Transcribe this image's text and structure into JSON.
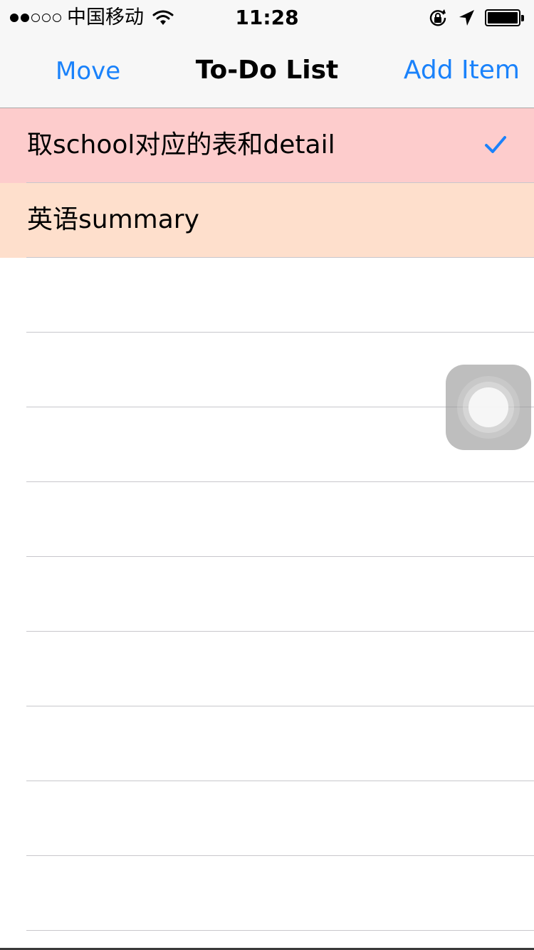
{
  "status_bar": {
    "carrier": "中国移动",
    "time": "11:28",
    "signal_bars_filled": 2,
    "signal_bars_total": 5
  },
  "nav": {
    "left_button": "Move",
    "title": "To-Do List",
    "right_button": "Add Item"
  },
  "items": [
    {
      "label": "取school对应的表和detail",
      "checked": true
    },
    {
      "label": "英语summary",
      "checked": false
    }
  ],
  "colors": {
    "accent": "#1a82fb",
    "row1_background": "#fdcccc",
    "row2_background": "#fedfcc"
  }
}
